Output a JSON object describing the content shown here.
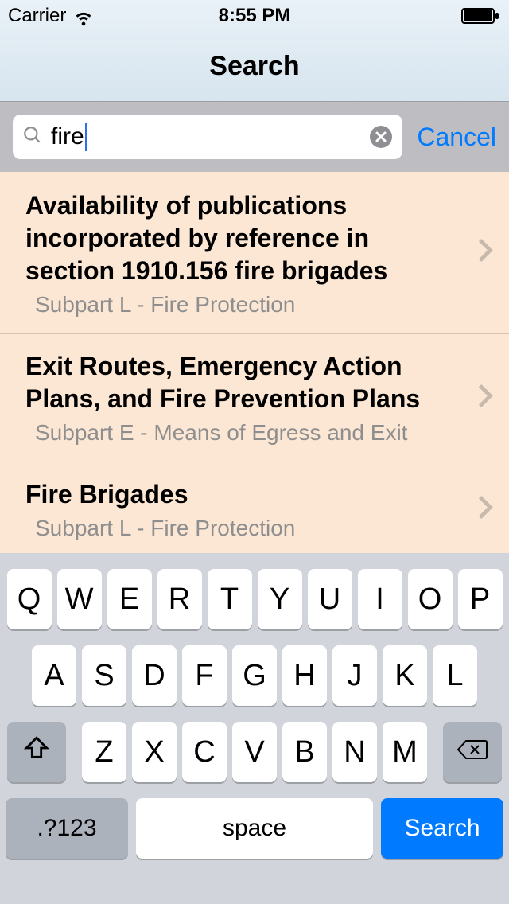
{
  "status_bar": {
    "carrier": "Carrier",
    "time": "8:55 PM"
  },
  "header": {
    "title": "Search"
  },
  "search": {
    "query": "fire",
    "cancel_label": "Cancel"
  },
  "results": [
    {
      "title": "Availability of publications incorporated by reference in section 1910.156 fire brigades",
      "subtitle": "Subpart L - Fire Protection"
    },
    {
      "title": "Exit Routes, Emergency Action Plans, and Fire Prevention Plans",
      "subtitle": "Subpart E - Means of Egress and Exit"
    },
    {
      "title": "Fire Brigades",
      "subtitle": "Subpart L - Fire Protection"
    }
  ],
  "keyboard": {
    "row1": [
      "Q",
      "W",
      "E",
      "R",
      "T",
      "Y",
      "U",
      "I",
      "O",
      "P"
    ],
    "row2": [
      "A",
      "S",
      "D",
      "F",
      "G",
      "H",
      "J",
      "K",
      "L"
    ],
    "row3": [
      "Z",
      "X",
      "C",
      "V",
      "B",
      "N",
      "M"
    ],
    "num_label": ".?123",
    "space_label": "space",
    "search_label": "Search"
  }
}
